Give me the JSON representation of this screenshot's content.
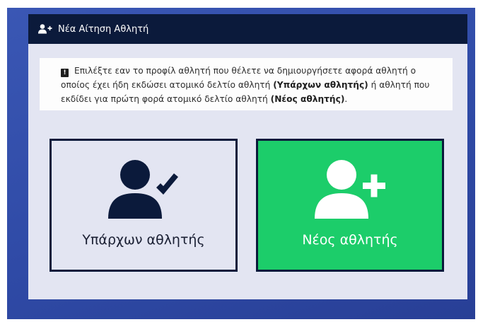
{
  "modal": {
    "title": "Νέα Αίτηση Αθλητή",
    "title_icon": "user-plus-icon"
  },
  "info": {
    "icon": "exclamation-icon",
    "text_part1": "Επιλέξτε εαν το προφίλ αθλητή που θέλετε να δημιουργήσετε αφορά αθλητή ο οποίος έχει ήδη εκδώσει ατομικό δελτίο αθλητή ",
    "bold1": "(Υπάρχων αθλητής)",
    "text_part2": " ή αθλητή που εκδίδει για πρώτη φορά ατομικό δελτίο αθλητή ",
    "bold2": "(Νέος αθλητής)",
    "text_part3": "."
  },
  "cards": {
    "existing": {
      "label": "Υπάρχων αθλητής",
      "icon": "user-check-icon"
    },
    "new": {
      "label": "Νέος αθλητής",
      "icon": "user-plus-icon"
    }
  },
  "colors": {
    "header_bg": "#0b1a3b",
    "modal_bg": "#e3e5f2",
    "backdrop": "#2f4aa6",
    "new_card_bg": "#1ccd6a"
  }
}
